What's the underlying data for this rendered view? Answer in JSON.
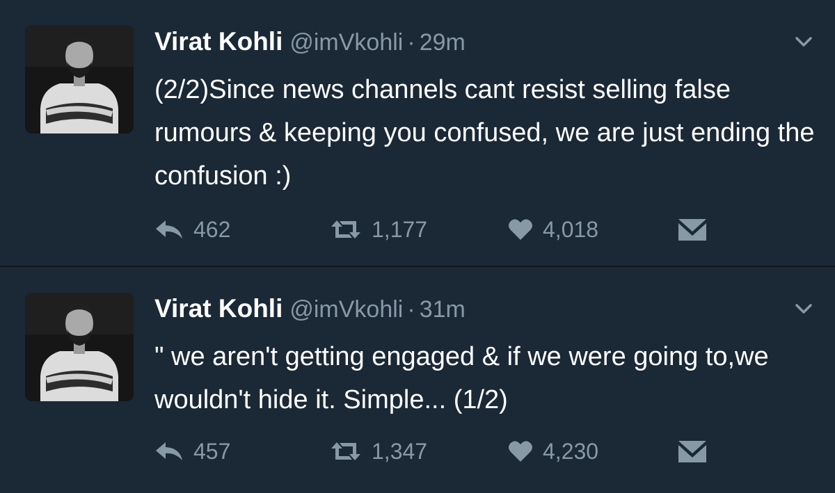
{
  "colors": {
    "background": "#1b2836",
    "divider": "#0f161d",
    "name_text": "#ffffff",
    "secondary_text": "#8899a6",
    "icon": "#8899a6"
  },
  "icons": {
    "reply": "reply-arrow-icon",
    "retweet": "retweet-icon",
    "like": "heart-icon",
    "dm": "envelope-icon",
    "caret": "chevron-down-icon"
  },
  "tweets": [
    {
      "name": "Virat Kohli",
      "handle": "@imVkohli",
      "separator": "·",
      "time": "29m",
      "text": "(2/2)Since news channels cant resist selling false rumours & keeping you confused, we are just ending the confusion :)",
      "replies": "462",
      "retweets": "1,177",
      "likes": "4,018"
    },
    {
      "name": "Virat Kohli",
      "handle": "@imVkohli",
      "separator": "·",
      "time": "31m",
      "text": "\" we aren't getting engaged & if we were going to,we wouldn't hide it. Simple... (1/2)",
      "replies": "457",
      "retweets": "1,347",
      "likes": "4,230"
    }
  ]
}
